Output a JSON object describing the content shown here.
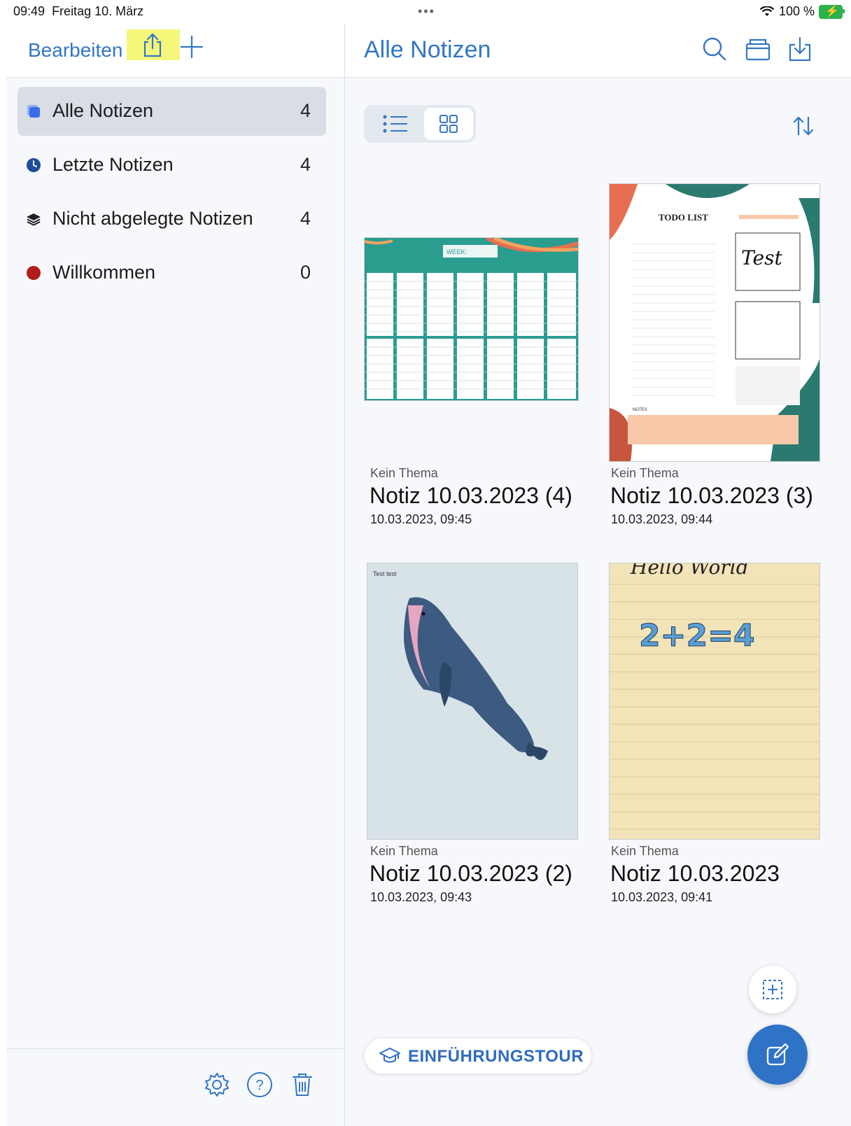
{
  "status": {
    "time": "09:49",
    "date": "Freitag 10. März",
    "battery": "100 %",
    "dots": "•••"
  },
  "sidebar": {
    "edit_label": "Bearbeiten",
    "items": [
      {
        "label": "Alle Notizen",
        "count": "4",
        "icon": "square-stack-icon",
        "color": "#3a6ee8"
      },
      {
        "label": "Letzte Notizen",
        "count": "4",
        "icon": "clock-icon",
        "color": "#1d4d9c"
      },
      {
        "label": "Nicht abgelegte Notizen",
        "count": "4",
        "icon": "layers-icon",
        "color": "#222222"
      },
      {
        "label": "Willkommen",
        "count": "0",
        "icon": "dot-icon",
        "color": "#b31c1c"
      }
    ],
    "footer_icons": [
      "gear-icon",
      "help-icon",
      "trash-icon"
    ]
  },
  "main": {
    "title": "Alle Notizen",
    "header_icons": [
      "search-icon",
      "archive-box-icon",
      "import-icon"
    ],
    "tour_label": "EINFÜHRUNGSTOUR",
    "notes": [
      {
        "theme": "Kein Thema",
        "title": "Notiz 10.03.2023 (4)",
        "date": "10.03.2023, 09:45",
        "thumb_text": "WEEK:"
      },
      {
        "theme": "Kein Thema",
        "title": "Notiz 10.03.2023 (3)",
        "date": "10.03.2023, 09:44",
        "thumb_text": "TODO LIST",
        "thumb_text2": "Test",
        "thumb_text3": "NOTES"
      },
      {
        "theme": "Kein Thema",
        "title": "Notiz 10.03.2023 (2)",
        "date": "10.03.2023, 09:43",
        "thumb_text": "Test test"
      },
      {
        "theme": "Kein Thema",
        "title": "Notiz 10.03.2023",
        "date": "10.03.2023, 09:41",
        "thumb_text": "Hello World",
        "thumb_text2": "2+2=4"
      }
    ]
  }
}
